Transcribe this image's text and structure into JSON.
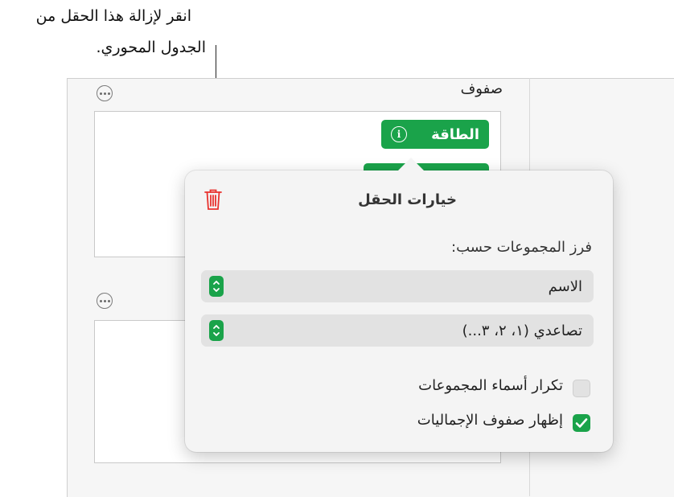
{
  "callout": {
    "line1": "انقر لإزالة هذا الحقل من",
    "line2": "الجدول المحوري."
  },
  "rows_section": {
    "title": "صفوف",
    "field_pill": "الطاقة"
  },
  "popover": {
    "title": "خيارات الحقل",
    "sort_label": "فرز المجموعات حسب:",
    "sort_by_select": "الاسم",
    "order_select": "تصاعدي (١، ٢، ٣...)",
    "repeat_group_names": {
      "label": "تكرار أسماء المجموعات",
      "checked": false
    },
    "show_totals_rows": {
      "label": "إظهار صفوف الإجماليات",
      "checked": true
    }
  },
  "colors": {
    "accent_green": "#1aa34a",
    "trash_red": "#e8322e"
  }
}
